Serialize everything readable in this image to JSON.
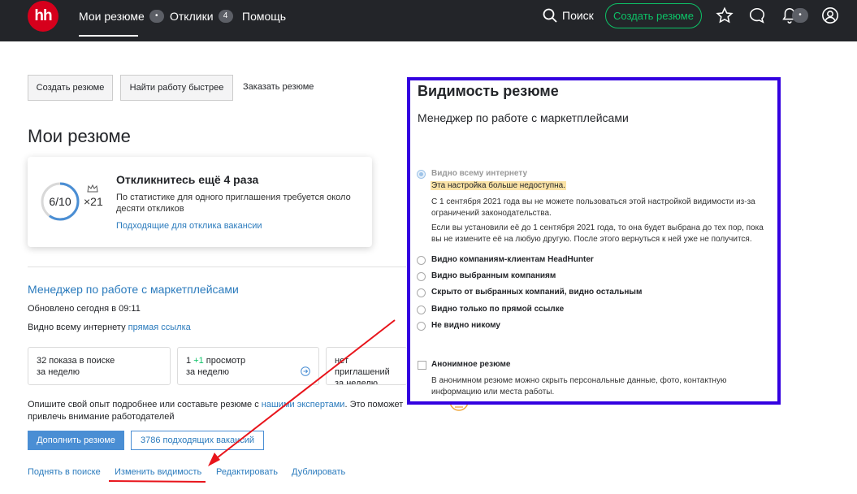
{
  "header": {
    "logo_text": "hh",
    "nav": [
      {
        "label": "Мои резюме",
        "count": "•"
      },
      {
        "label": "Отклики",
        "count": "4"
      },
      {
        "label": "Помощь"
      }
    ],
    "search_label": "Поиск",
    "create_resume_label": "Создать резюме",
    "notif_badge": "•"
  },
  "actions": {
    "create": "Создать резюме",
    "find_faster": "Найти работу быстрее",
    "order": "Заказать резюме"
  },
  "page_title": "Мои резюме",
  "progress_card": {
    "progress_text": "6/10",
    "progress_fraction": 0.6,
    "multiplier": "×21",
    "title": "Откликнитесь ещё 4 раза",
    "desc": "По статистике для одного приглашения требуется около десяти откликов",
    "link": "Подходящие для отклика вакансии"
  },
  "resume": {
    "title": "Менеджер по работе с маркетплейсами",
    "updated": "Обновлено сегодня в 09:11",
    "visibility_prefix": "Видно всему интернету",
    "visibility_link": "прямая ссылка",
    "stats": [
      {
        "line1": "32 показа в поиске",
        "line2": "за неделю"
      },
      {
        "line1_pre": "1 ",
        "line1_accent": "+1",
        "line1_post": " просмотр",
        "line2": "за неделю"
      },
      {
        "line1": "нет приглашений",
        "line2": "за неделю"
      }
    ],
    "hint_pre": "Опишите свой опыт подробнее или составьте резюме с ",
    "hint_link": "нашими экспертами",
    "hint_post": ". Это поможет",
    "hint_line2": "привлечь внимание работодателей",
    "btn_complete": "Дополнить резюме",
    "btn_vacancies": "3786 подходящих вакансий",
    "footer_links": [
      "Поднять в поиске",
      "Изменить видимость",
      "Редактировать",
      "Дублировать"
    ]
  },
  "visibility_panel": {
    "title": "Видимость резюме",
    "subtitle": "Менеджер по работе с маркетплейсами",
    "disabled_option": "Видно всему интернету",
    "warning": "Эта настройка больше недоступна.",
    "para1_l1": "С 1 сентября 2021 года вы не можете пользоваться этой настройкой видимости из-за",
    "para1_l2": "ограничений законодательства.",
    "para2_l1": "Если вы установили её до 1 сентября 2021 года, то она будет выбрана до тех пор, пока",
    "para2_l2": "вы не измените её на любую другую. После этого вернуться к ней уже не получится.",
    "options": [
      "Видно компаниям-клиентам HeadHunter",
      "Видно выбранным компаниям",
      "Скрыто от выбранных компаний, видно остальным",
      "Видно только по прямой ссылке",
      "Не видно никому"
    ],
    "anon_label": "Анонимное резюме",
    "anon_desc_l1": "В анонимном резюме можно скрыть персональные данные, фото, контактную",
    "anon_desc_l2": "информацию или места работы."
  },
  "colors": {
    "topbar": "#232529",
    "brand_red": "#d6001c",
    "accent_green": "#0dc267",
    "link_blue": "#2b7bbd",
    "panel_border": "#3300e0",
    "annotation_red": "#e8141b"
  }
}
